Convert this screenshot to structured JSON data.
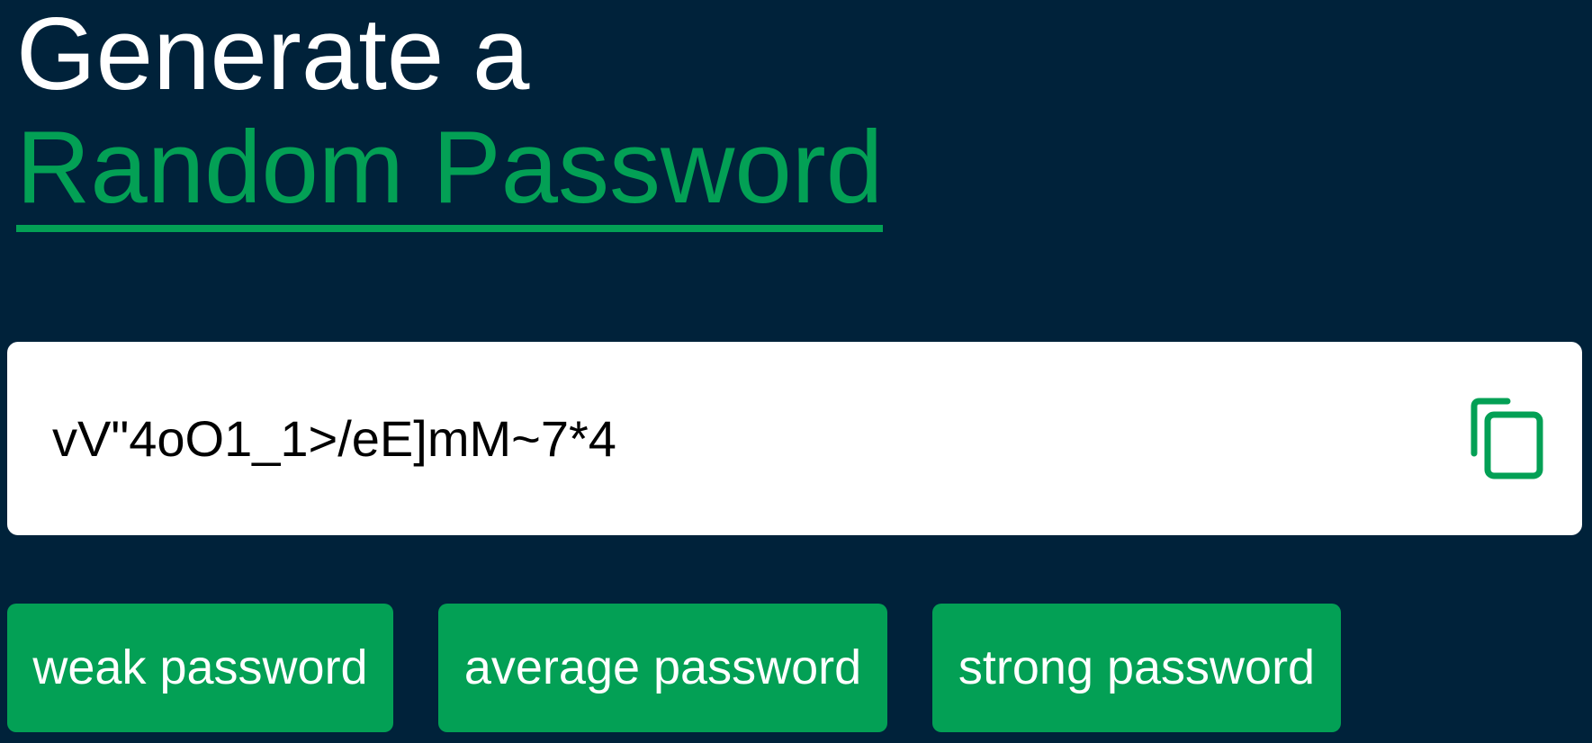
{
  "heading": {
    "line1": "Generate a",
    "line2": "Random Password"
  },
  "password": {
    "value": "vV\"4oO1_1>/eE]mM~7*4"
  },
  "copy_icon": {
    "name": "copy-icon",
    "color": "#03a055"
  },
  "buttons": [
    {
      "label": "weak password"
    },
    {
      "label": "average password"
    },
    {
      "label": "strong password"
    }
  ],
  "colors": {
    "background": "#00223a",
    "accent": "#03a055",
    "text_light": "#ffffff",
    "card": "#ffffff"
  }
}
